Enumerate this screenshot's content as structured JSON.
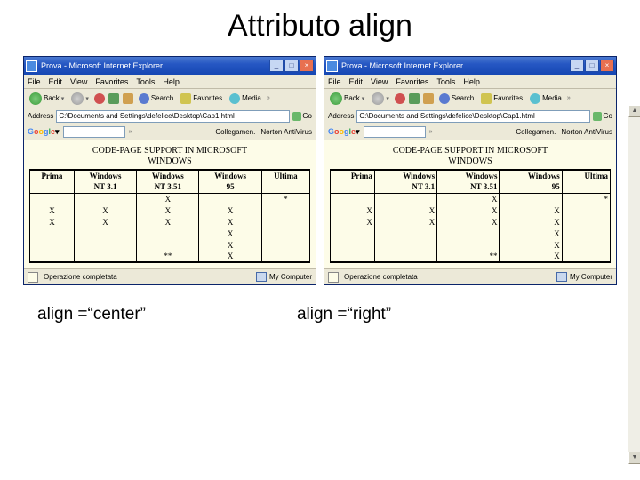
{
  "slide": {
    "title": "Attributo align"
  },
  "captions": {
    "left": "align =“center”",
    "right": "align =“right”"
  },
  "ie_window": {
    "title": "Prova - Microsoft Internet Explorer",
    "menubar": [
      "File",
      "Edit",
      "View",
      "Favorites",
      "Tools",
      "Help"
    ],
    "toolbar": {
      "back": "Back",
      "search": "Search",
      "favorites": "Favorites",
      "media": "Media"
    },
    "addressbar": {
      "label": "Address",
      "value": "C:\\Documents and Settings\\defelice\\Desktop\\Cap1.html",
      "go": "Go"
    },
    "googlebar": {
      "links": [
        "Collegamen.",
        "Norton AntiVirus"
      ]
    },
    "statusbar": {
      "status": "Operazione completata",
      "right": "My Computer"
    }
  },
  "content": {
    "title_line1": "CODE-PAGE SUPPORT IN MICROSOFT",
    "title_line2": "WINDOWS",
    "headers_row1": [
      "Prima",
      "Windows",
      "Windows",
      "Windows",
      "Ultima"
    ],
    "headers_row2": [
      "",
      "NT 3.1",
      "NT 3.51",
      "95",
      ""
    ],
    "rows": [
      [
        "",
        "",
        "X",
        "",
        "*"
      ],
      [
        "X",
        "X",
        "X",
        "X",
        ""
      ],
      [
        "X",
        "X",
        "X",
        "X",
        ""
      ],
      [
        "",
        "",
        "",
        "X",
        ""
      ],
      [
        "",
        "",
        "",
        "X",
        ""
      ],
      [
        "",
        "",
        "**",
        "X",
        ""
      ]
    ]
  }
}
